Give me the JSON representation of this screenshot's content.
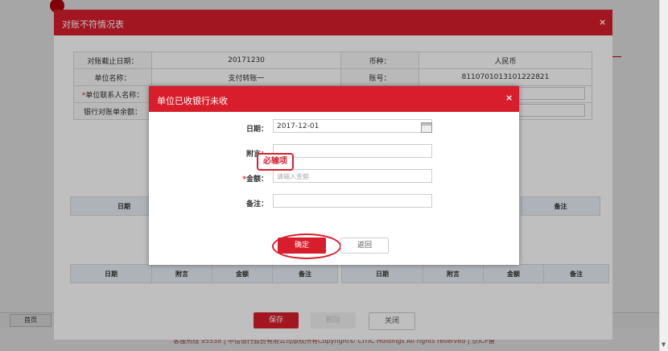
{
  "bg_page": {
    "home_tab": "首页",
    "footer": "客服热线 95558 | 中信银行股份有限公司版权所有Copyright© CITIC Holdings All rights reserved | 京ICP备"
  },
  "outer_dialog": {
    "title": "对账不符情况表",
    "close": "×",
    "rows": [
      {
        "label": "对账截止日期：",
        "value": "20171230",
        "label2": "币种：",
        "value2": "人民币"
      },
      {
        "label": "单位名称：",
        "value": "支付转账一",
        "label2": "账号：",
        "value2": "8110701013101222821"
      },
      {
        "label": "单位联系人名称：",
        "required": "*"
      },
      {
        "label": "银行对账单余额："
      }
    ],
    "table_top": {
      "headers_left": [
        "日期"
      ],
      "headers_right": [
        "备注"
      ]
    },
    "table_bottom": {
      "headers_left": [
        "日期",
        "附言",
        "金额",
        "备注"
      ],
      "headers_right": [
        "日期",
        "附言",
        "金额",
        "备注"
      ]
    },
    "buttons": {
      "save": "保存",
      "delete": "删除",
      "close": "关闭"
    }
  },
  "inner_dialog": {
    "title": "单位已收银行未收",
    "close": "×",
    "fields": {
      "date_label": "日期：",
      "date_value": "2017-12-01",
      "memo_label": "附言：",
      "amount_label": "金额：",
      "amount_required": "*",
      "amount_placeholder": "请输入金额",
      "remark_label": "备注："
    },
    "required_tag": "必输项",
    "buttons": {
      "ok": "确定",
      "back": "返回"
    }
  },
  "colors": {
    "accent": "#d81e2c",
    "header_bg": "#e9eff7"
  }
}
